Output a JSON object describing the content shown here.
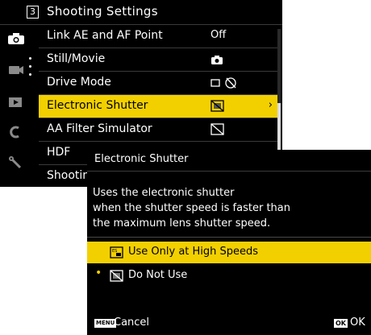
{
  "menu": {
    "page_number": "3",
    "title": "Shooting Settings",
    "sidebar": [
      {
        "icon": "camera-icon",
        "active": true
      },
      {
        "icon": "video-camera-icon",
        "active": false
      },
      {
        "icon": "playback-icon",
        "active": false
      },
      {
        "icon": "setup-icon",
        "active": false
      },
      {
        "icon": "wrench-icon",
        "active": false
      }
    ],
    "rows": [
      {
        "label": "Link AE and AF Point",
        "value": "Off"
      },
      {
        "label": "Still/Movie",
        "value_icon": "still-camera-icon"
      },
      {
        "label": "Drive Mode",
        "value_icon": "single-frame-drive-icon"
      },
      {
        "label": "Electronic Shutter",
        "value_icon": "electronic-shutter-off-icon",
        "selected": true,
        "arrow": "›"
      },
      {
        "label": "AA Filter Simulator",
        "value_icon": "aa-filter-off-icon"
      },
      {
        "label": "HDF"
      },
      {
        "label": "Shootin"
      }
    ]
  },
  "dialog": {
    "title": "Electronic Shutter",
    "description": [
      "Uses the electronic shutter",
      "when the shutter speed is faster than",
      "the maximum lens shutter speed."
    ],
    "options": [
      {
        "label": "Use Only at High Speeds",
        "icon": "es-auto-icon",
        "highlighted": true
      },
      {
        "label": "Do Not Use",
        "icon": "es-off-icon",
        "current": true,
        "bullet": "•"
      }
    ],
    "footer": {
      "cancel_key": "MENU",
      "cancel_label": "Cancel",
      "ok_key": "OK",
      "ok_label": "OK"
    }
  },
  "colors": {
    "highlight": "#f2d000",
    "background": "#000000",
    "text": "#ffffff"
  }
}
